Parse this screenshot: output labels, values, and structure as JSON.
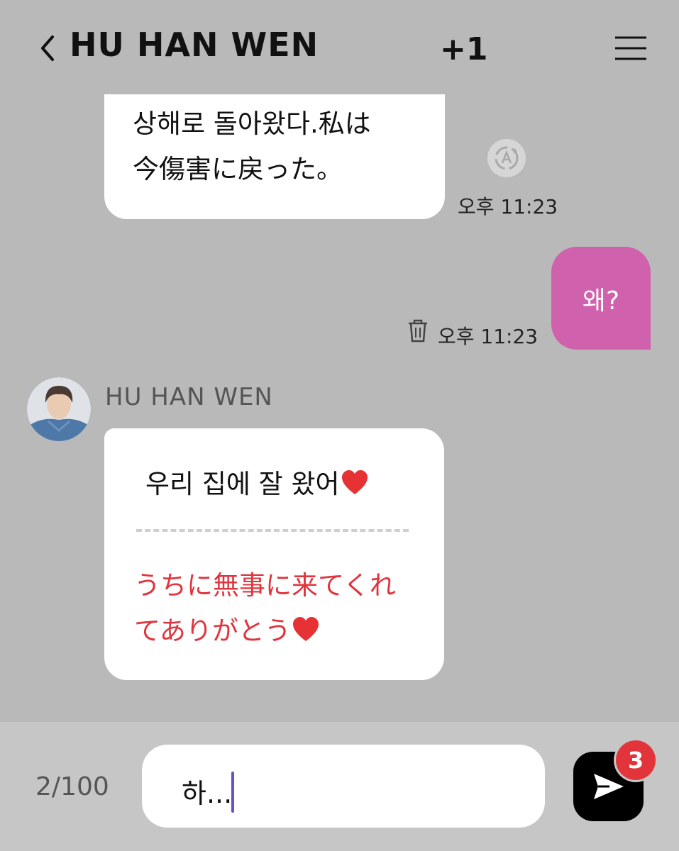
{
  "header": {
    "title": "HU HAN WEN",
    "participant_count": "+1"
  },
  "messages": {
    "incoming_1": {
      "line1": "상해로 돌아왔다.私は",
      "line2": "今傷害に戻った。",
      "time": "오후 11:23"
    },
    "outgoing_1": {
      "text": "왜?",
      "time": "오후 11:23"
    },
    "incoming_2": {
      "sender": "HU HAN WEN",
      "original": "우리 집에 잘 왔어",
      "translation_line1": "うちに無事に来てくれ",
      "translation_line2": "てありがとう"
    }
  },
  "composer": {
    "char_count": "2/100",
    "input_value": "하...",
    "badge_count": "3"
  },
  "colors": {
    "background": "#b9b9b9",
    "outgoing_bubble": "#d061ad",
    "translation_text": "#e0353f",
    "badge": "#e2353b"
  },
  "icons": [
    "back-icon",
    "menu-icon",
    "translate-icon",
    "trash-icon",
    "heart-emoji",
    "send-icon"
  ]
}
